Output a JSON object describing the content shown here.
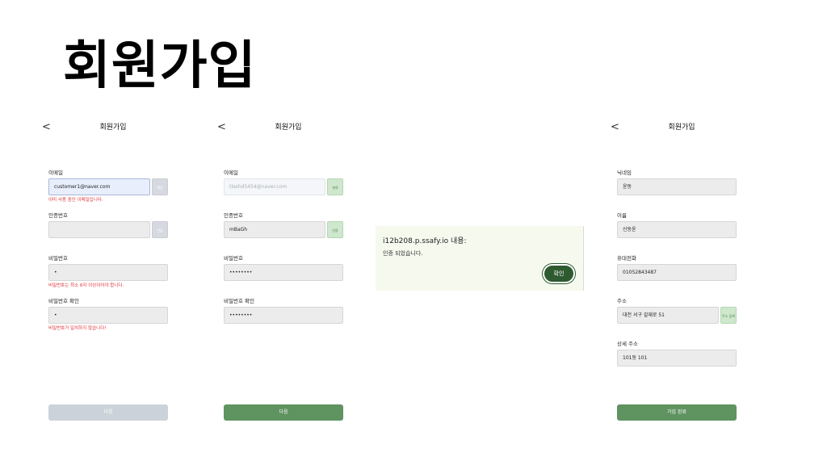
{
  "page": {
    "title": "회원가입"
  },
  "screen1": {
    "header_title": "회원가입",
    "back_icon": "chevron-left-icon",
    "email": {
      "label": "이메일",
      "value": "customer1@naver.com",
      "btn": "확인",
      "error": "이미 사용 중인 이메일입니다."
    },
    "code": {
      "label": "인증번호",
      "value": "",
      "btn": "인증"
    },
    "password": {
      "label": "비밀번호",
      "value": "•",
      "error": "비밀번호는 최소 6자 이상이어야 합니다."
    },
    "password_confirm": {
      "label": "비밀번호 확인",
      "value": "•",
      "error": "비밀번호가 일치하지 않습니다!"
    },
    "next_label": "다음"
  },
  "screen2": {
    "header_title": "회원가입",
    "back_icon": "chevron-left-icon",
    "email": {
      "label": "이메일",
      "value": "tlsehd5454@naver.com",
      "btn": "완료"
    },
    "code": {
      "label": "인증번호",
      "value": "mBaGh",
      "btn": "인증"
    },
    "password": {
      "label": "비밀번호",
      "value": "••••••••"
    },
    "password_confirm": {
      "label": "비밀번호 확인",
      "value": "••••••••"
    },
    "next_label": "다음"
  },
  "dialog": {
    "title": "i12b208.p.ssafy.io 내용:",
    "message": "인증 되었습니다.",
    "ok_label": "확인"
  },
  "screen3": {
    "header_title": "회원가입",
    "back_icon": "chevron-left-icon",
    "nickname": {
      "label": "닉네임",
      "value": "윤동"
    },
    "name": {
      "label": "이름",
      "value": "신동윤"
    },
    "phone": {
      "label": "휴대전화",
      "value": "01052843487"
    },
    "address": {
      "label": "주소",
      "value": "대전 서구 갈재로 51",
      "btn": "주소 검색"
    },
    "address_detail": {
      "label": "상세 주소",
      "value": "101동 101"
    },
    "submit_label": "가입 완료"
  },
  "colors": {
    "accent_green": "#5f9360",
    "dialog_ok": "#2e5a30",
    "error": "#e0333a",
    "disabled": "#ccd2d9"
  }
}
